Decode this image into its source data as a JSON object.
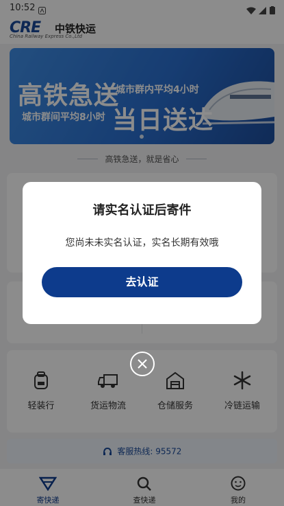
{
  "status_bar": {
    "time": "10:52"
  },
  "header": {
    "logo_text": "CRE",
    "logo_cn": "中铁快运",
    "logo_en": "China Railway Express Co.,Ltd"
  },
  "banner": {
    "headline_1": "高铁急送",
    "sub_1": "城市群内平均4小时",
    "sub_2": "城市群间平均8小时",
    "headline_2": "当日送达"
  },
  "slogan": "高铁急送，就是省心",
  "services": [
    {
      "label": "轻装行",
      "icon": "backpack-icon"
    },
    {
      "label": "货运物流",
      "icon": "truck-icon"
    },
    {
      "label": "仓储服务",
      "icon": "warehouse-icon"
    },
    {
      "label": "冷链运输",
      "icon": "snowflake-icon"
    }
  ],
  "hotline": "客服热线: 95572",
  "tabs": [
    {
      "label": "寄快递",
      "icon": "send-icon",
      "active": true
    },
    {
      "label": "查快递",
      "icon": "search-icon",
      "active": false
    },
    {
      "label": "我的",
      "icon": "profile-icon",
      "active": false
    }
  ],
  "dialog": {
    "title": "请实名认证后寄件",
    "message": "您尚未未实名认证，实名长期有效哦",
    "button": "去认证"
  },
  "colors": {
    "brand": "#0d3b8c",
    "overlay": "rgba(0,0,0,0.45)"
  }
}
